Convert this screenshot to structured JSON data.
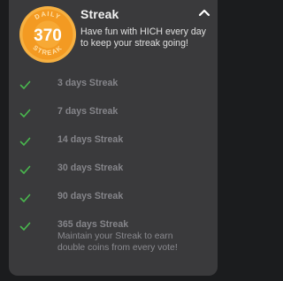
{
  "colors": {
    "page_background": "#1b1c1e",
    "card_background": "#3a3a3c",
    "badge_orange": "#f5a128",
    "check_green": "#49b84e",
    "muted_text": "#85858a"
  },
  "streak": {
    "badge_top": "DAILY",
    "badge_number": "370",
    "badge_bottom": "STREAK",
    "title": "Streak",
    "subtitle": "Have fun with HICH every day to keep your streak going!",
    "collapse_icon": "chevron-up-icon"
  },
  "milestones": [
    {
      "label": "3 days Streak",
      "icon": "check-icon",
      "completed": true
    },
    {
      "label": "7 days Streak",
      "icon": "check-icon",
      "completed": true
    },
    {
      "label": "14 days Streak",
      "icon": "check-icon",
      "completed": true
    },
    {
      "label": "30 days Streak",
      "icon": "check-icon",
      "completed": true
    },
    {
      "label": "90 days Streak",
      "icon": "check-icon",
      "completed": true
    },
    {
      "label": "365 days Streak",
      "icon": "check-icon",
      "completed": true,
      "description": "Maintain your Streak to earn double coins from every vote!"
    }
  ]
}
